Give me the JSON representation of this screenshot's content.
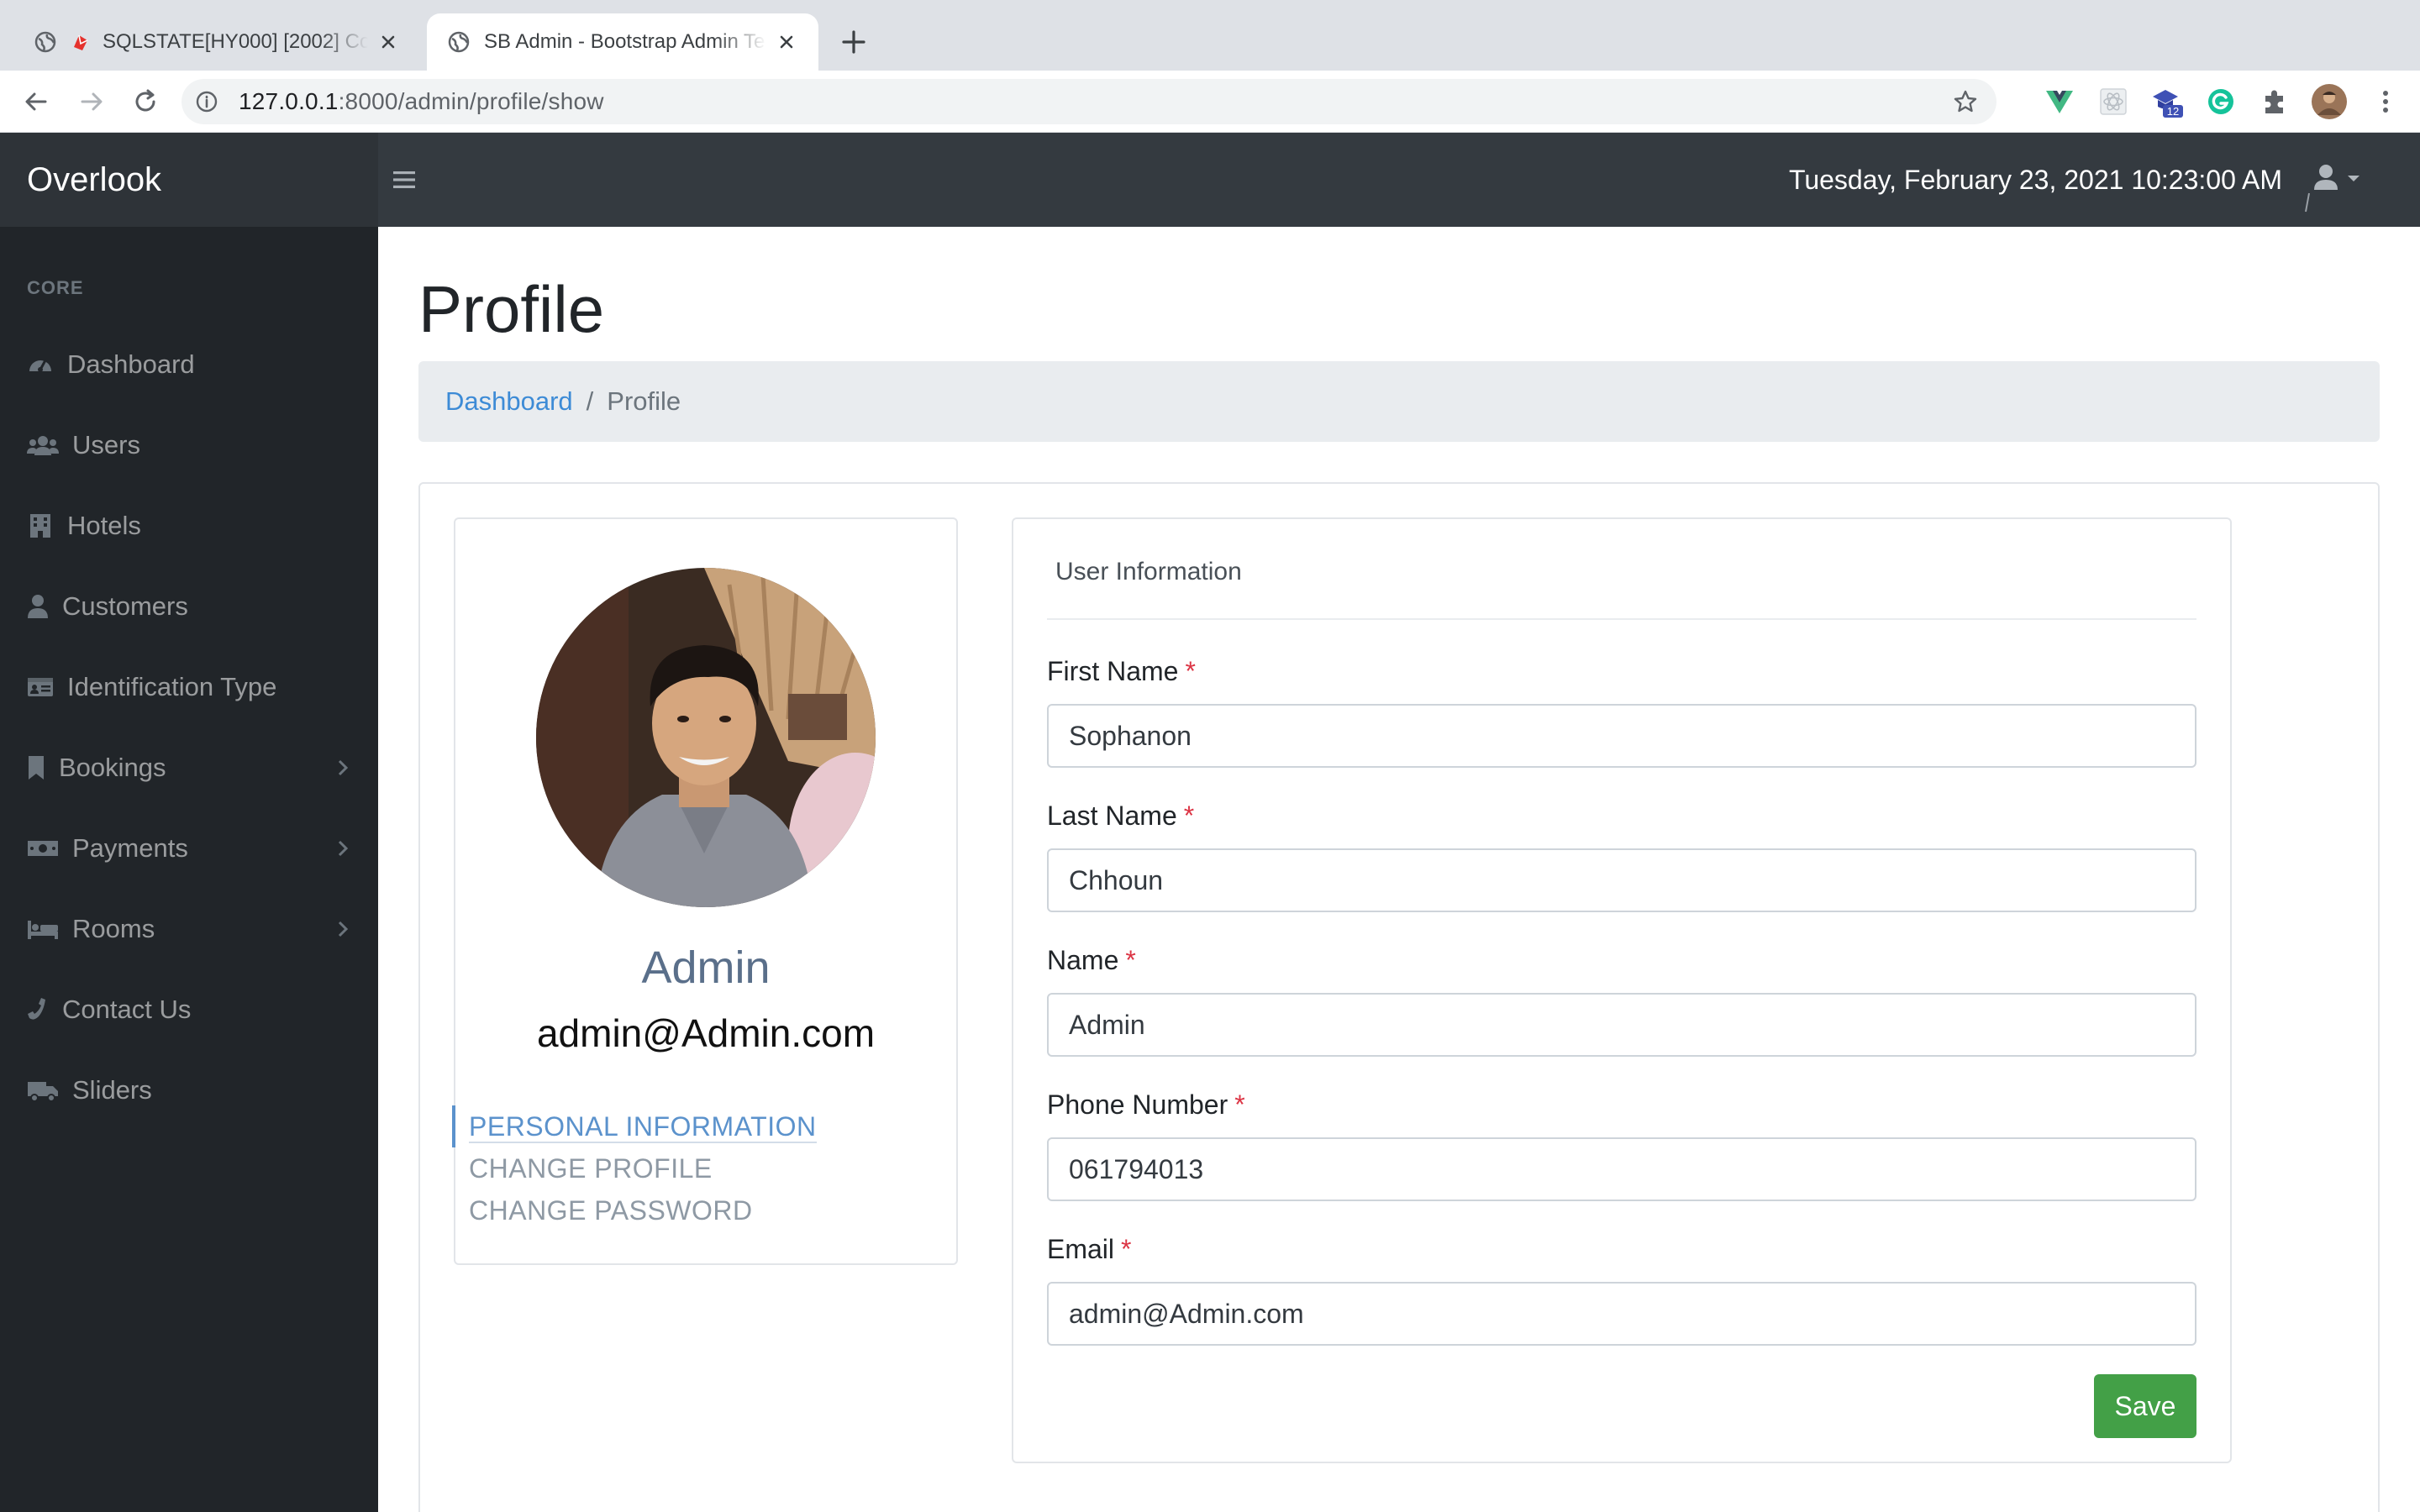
{
  "browser": {
    "tabs": [
      {
        "title": "SQLSTATE[HY000] [2002] Connection refused",
        "active": false
      },
      {
        "title": "SB Admin - Bootstrap Admin Template",
        "active": true
      }
    ],
    "url_host": "127.0.0.1",
    "url_rest": ":8000/admin/profile/show",
    "extension_badge": "12"
  },
  "navbar": {
    "brand": "Overlook",
    "datetime": "Tuesday, February 23, 2021 10:23:00 AM"
  },
  "sidebar": {
    "heading": "CORE",
    "items": [
      {
        "label": "Dashboard",
        "icon": "tachometer-icon",
        "has_children": false
      },
      {
        "label": "Users",
        "icon": "users-icon",
        "has_children": false
      },
      {
        "label": "Hotels",
        "icon": "building-icon",
        "has_children": false
      },
      {
        "label": "Customers",
        "icon": "user-icon",
        "has_children": false
      },
      {
        "label": "Identification Type",
        "icon": "id-card-icon",
        "has_children": false
      },
      {
        "label": "Bookings",
        "icon": "bookmark-icon",
        "has_children": true
      },
      {
        "label": "Payments",
        "icon": "money-bill-icon",
        "has_children": true
      },
      {
        "label": "Rooms",
        "icon": "bed-icon",
        "has_children": true
      },
      {
        "label": "Contact Us",
        "icon": "phone-icon",
        "has_children": false
      },
      {
        "label": "Sliders",
        "icon": "truck-icon",
        "has_children": false
      }
    ]
  },
  "page": {
    "title": "Profile",
    "breadcrumb": {
      "link": "Dashboard",
      "separator": "/",
      "current": "Profile"
    }
  },
  "profile": {
    "name": "Admin",
    "email": "admin@Admin.com",
    "menu": [
      {
        "label": "PERSONAL INFORMATION",
        "active": true
      },
      {
        "label": "CHANGE PROFILE",
        "active": false
      },
      {
        "label": "CHANGE PASSWORD",
        "active": false
      }
    ]
  },
  "form": {
    "title": "User Information",
    "required_marker": "*",
    "fields": [
      {
        "label": "First Name",
        "value": "Sophanon"
      },
      {
        "label": "Last Name",
        "value": "Chhoun"
      },
      {
        "label": "Name",
        "value": "Admin"
      },
      {
        "label": "Phone Number",
        "value": "061794013"
      },
      {
        "label": "Email",
        "value": "admin@Admin.com"
      }
    ],
    "save_label": "Save"
  },
  "colors": {
    "navbar_bg": "#343a40",
    "sidebar_bg": "#212529",
    "link": "#3d8bd6",
    "required": "#dc3545",
    "save_button": "#43a047"
  }
}
